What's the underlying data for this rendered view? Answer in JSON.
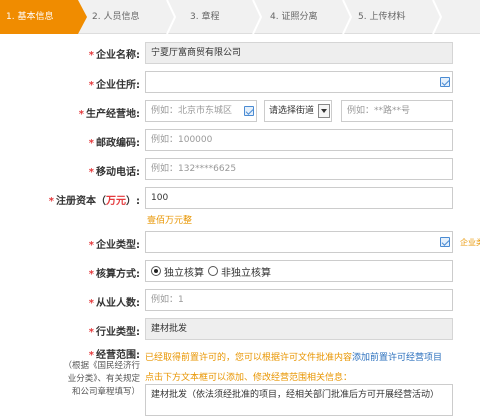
{
  "steps": [
    {
      "label": "1. 基本信息",
      "active": true
    },
    {
      "label": "2. 人员信息",
      "active": false
    },
    {
      "label": "3. 章程",
      "active": false
    },
    {
      "label": "4. 证照分离",
      "active": false
    },
    {
      "label": "5. 上传材料",
      "active": false
    }
  ],
  "form": {
    "company_name": {
      "label": "企业名称:",
      "value": "宁夏厅富商贸有限公司"
    },
    "address": {
      "label": "企业住所:",
      "value": ""
    },
    "business_location": {
      "label": "生产经营地:",
      "district_placeholder": "例如：北京市东城区",
      "street_select": "请选择街道",
      "detail_placeholder": "例如：**路**号"
    },
    "postcode": {
      "label": "邮政编码:",
      "placeholder": "例如：100000"
    },
    "mobile": {
      "label": "移动电话:",
      "placeholder": "例如：132****6625"
    },
    "capital": {
      "label_prefix": "注册资本（",
      "label_unit": "万元",
      "label_suffix": "）:",
      "value": "100",
      "hint": "壹佰万元整"
    },
    "company_type": {
      "label": "企业类型:",
      "value": "",
      "side_hint": "企业类"
    },
    "accounting": {
      "label": "核算方式:",
      "option1": "独立核算",
      "option2": "非独立核算",
      "selected": "独立核算"
    },
    "employees": {
      "label": "从业人数:",
      "placeholder": "例如：1"
    },
    "industry": {
      "label": "行业类型:",
      "value": "建材批发"
    },
    "scope": {
      "label": "经营范围:",
      "note_lines": [
        "（根据《国民经济行",
        "业分类》、有关规定",
        "和公司章程填写）"
      ],
      "hint_prefix": "已经取得前置许可的，您可以根据许可文件批准内容",
      "hint_link": "添加前置许可经营项目",
      "hint2": "点击下方文本框可以添加、修改经营范围相关信息：",
      "value": "建材批发（依法须经批准的项目，经相关部门批准后方可开展经营活动）"
    }
  },
  "colors": {
    "accent": "#f08c00",
    "required": "#e4393c",
    "hint": "#e89500",
    "link": "#2a6fbd"
  }
}
